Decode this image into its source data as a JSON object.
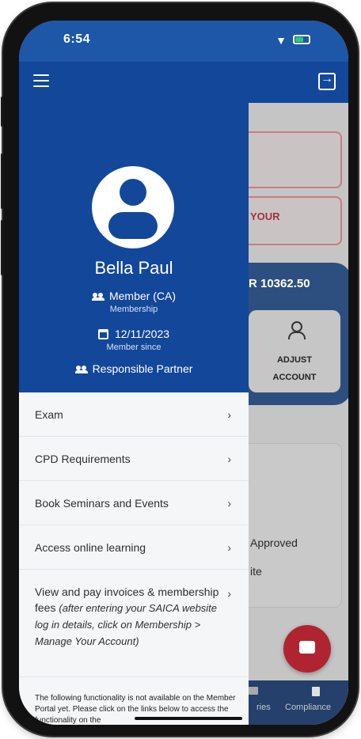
{
  "status_bar": {
    "time": "6:54"
  },
  "background": {
    "card_text": "YOUR",
    "balance": "R 10362.50",
    "adjust_line1": "ADJUST",
    "adjust_line2": "ACCOUNT",
    "approved": "Approved",
    "partial": "ite",
    "nav_partial1": "ries",
    "nav_compliance": "Compliance"
  },
  "drawer": {
    "name": "Bella Paul",
    "membership_value": "Member (CA)",
    "membership_label": "Membership",
    "member_since_value": "12/11/2023",
    "member_since_label": "Member since",
    "role": "Responsible Partner",
    "menu": [
      {
        "label": "Exam"
      },
      {
        "label": "CPD Requirements"
      },
      {
        "label": "Book Seminars and Events"
      },
      {
        "label": "Access online learning"
      },
      {
        "label": "View and pay invoices & membership fees",
        "note": "(after entering your SAICA website log in details, click on Membership > Manage Your Account)"
      }
    ],
    "notice": "The following functionality is not available on the Member Portal yet. Please click on the links below to access the functionality on the"
  },
  "colors": {
    "primary": "#13479a",
    "accent": "#b02431"
  }
}
